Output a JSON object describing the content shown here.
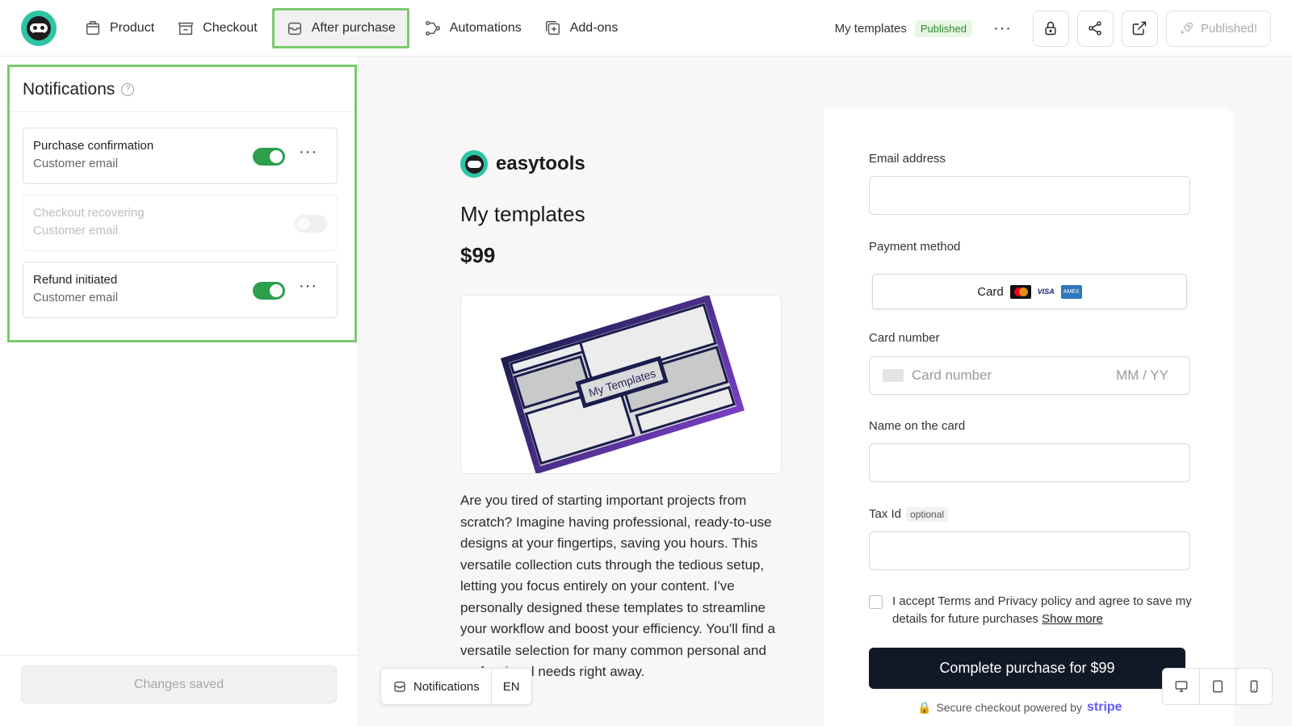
{
  "nav": {
    "items": [
      {
        "label": "Product",
        "icon": "box-icon"
      },
      {
        "label": "Checkout",
        "icon": "store-icon"
      },
      {
        "label": "After purchase",
        "icon": "inbox-icon",
        "active": true
      },
      {
        "label": "Automations",
        "icon": "flow-icon"
      },
      {
        "label": "Add-ons",
        "icon": "plus-square-icon"
      }
    ]
  },
  "header": {
    "template_name": "My templates",
    "status_badge": "Published",
    "more": "···",
    "published_button": "Published!"
  },
  "notifications": {
    "title": "Notifications",
    "help": "?",
    "items": [
      {
        "title": "Purchase confirmation",
        "subtitle": "Customer email",
        "enabled": true,
        "more": "···"
      },
      {
        "title": "Checkout recovering",
        "subtitle": "Customer email",
        "enabled": false
      },
      {
        "title": "Refund initiated",
        "subtitle": "Customer email",
        "enabled": true,
        "more": "···"
      }
    ]
  },
  "footer": {
    "changes_label": "Changes saved"
  },
  "preview": {
    "brand": "easytools",
    "product_title": "My templates",
    "price": "$99",
    "image_caption": "My Templates",
    "description": "Are you tired of starting important projects from scratch? Imagine having professional, ready-to-use designs at your fingertips, saving you hours. This versatile collection cuts through the tedious setup, letting you focus entirely on your content. I've personally designed these templates to streamline your workflow and boost your efficiency. You'll find a versatile selection for many common personal and professional needs right away.",
    "form": {
      "email_label": "Email address",
      "payment_label": "Payment method",
      "card_option": "Card",
      "visa": "VISA",
      "amex": "AMEX",
      "card_number_label": "Card number",
      "card_number_placeholder": "Card number",
      "expiry_placeholder": "MM / YY",
      "name_label": "Name on the card",
      "tax_label": "Tax Id",
      "tax_optional": "optional",
      "accept_text": "I accept Terms and Privacy policy and agree to save my details for future purchases",
      "show_more": "Show more",
      "complete_button": "Complete purchase for $99",
      "secure_text": "Secure checkout powered by",
      "stripe": "stripe"
    }
  },
  "float_bar": {
    "notifications": "Notifications",
    "language": "EN"
  },
  "colors": {
    "accent_green": "#2d9e4b",
    "highlight": "#7bc96f",
    "brand_teal": "#2ec4a6",
    "button_dark": "#111827"
  }
}
